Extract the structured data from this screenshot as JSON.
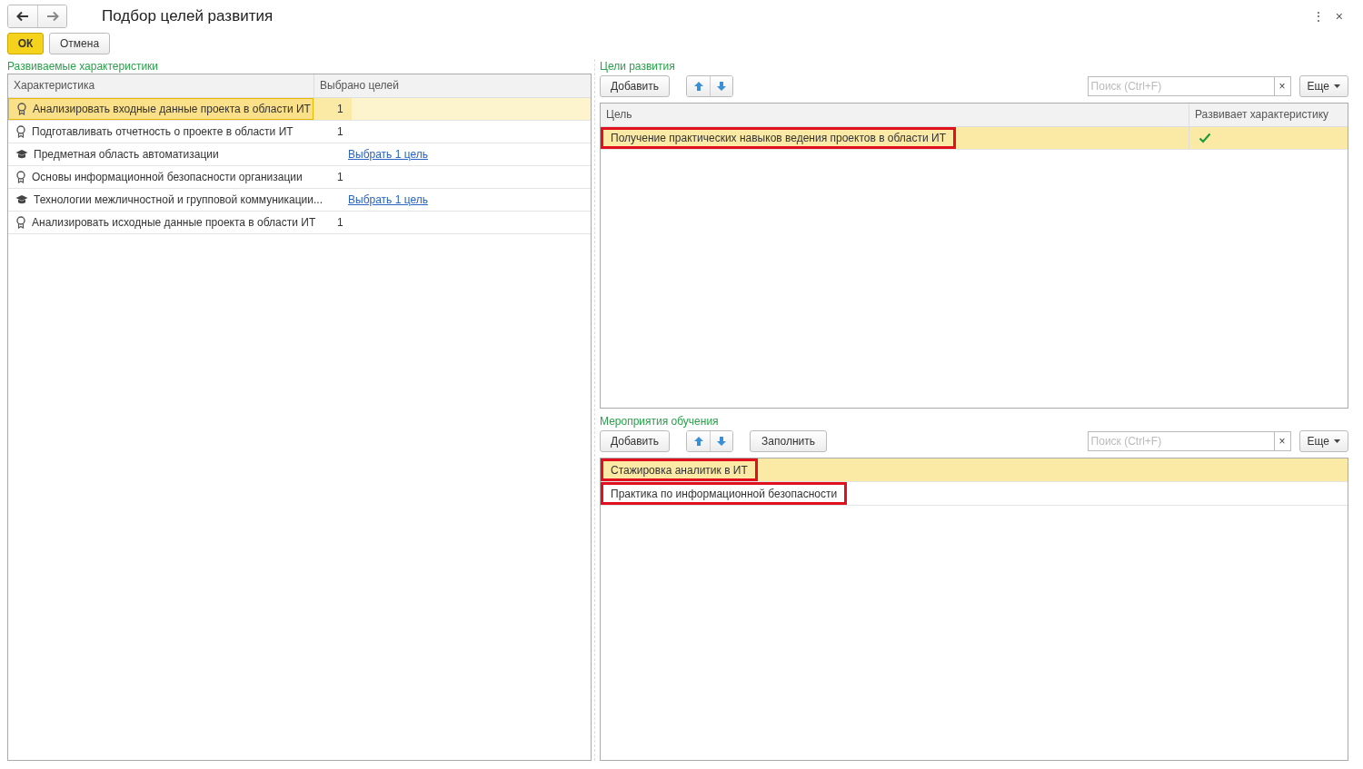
{
  "window": {
    "title": "Подбор целей развития",
    "menu_icon": "⋮",
    "close_icon": "×"
  },
  "actions": {
    "ok": "ОК",
    "cancel": "Отмена"
  },
  "characteristics": {
    "title": "Развиваемые характеристики",
    "columns": [
      "Характеристика",
      "Выбрано целей"
    ],
    "rows": [
      {
        "kind": "skill",
        "name": "Анализировать входные данные проекта в области ИТ",
        "count": "1",
        "selected": true
      },
      {
        "kind": "skill",
        "name": "Подготавливать отчетность о проекте в области ИТ",
        "count": "1",
        "selected": false
      },
      {
        "kind": "knowledge",
        "name": "Предметная область автоматизации",
        "link": "Выбрать 1 цель",
        "selected": false
      },
      {
        "kind": "skill",
        "name": "Основы информационной безопасности организации",
        "count": "1",
        "selected": false
      },
      {
        "kind": "knowledge",
        "name": "Технологии межличностной и групповой коммуникации...",
        "link": "Выбрать 1 цель",
        "selected": false
      },
      {
        "kind": "skill",
        "name": "Анализировать исходные данные проекта в области ИТ",
        "count": "1",
        "selected": false
      }
    ]
  },
  "goals": {
    "title": "Цели развития",
    "add_button": "Добавить",
    "search": {
      "placeholder": "Поиск (Ctrl+F)"
    },
    "clear_icon": "×",
    "more_button": "Еще",
    "columns": [
      "Цель",
      "Развивает характеристику"
    ],
    "rows": [
      {
        "name": "Получение практических навыков ведения проектов в области ИТ",
        "develops": true,
        "selected": true,
        "highlighted": true
      }
    ]
  },
  "activities": {
    "title": "Мероприятия обучения",
    "add_button": "Добавить",
    "fill_button": "Заполнить",
    "search": {
      "placeholder": "Поиск (Ctrl+F)"
    },
    "clear_icon": "×",
    "more_button": "Еще",
    "rows": [
      {
        "name": "Стажировка аналитик в ИТ",
        "selected": true,
        "highlighted": true
      },
      {
        "name": "Практика по информационной безопасности",
        "selected": false,
        "highlighted": true
      }
    ]
  }
}
